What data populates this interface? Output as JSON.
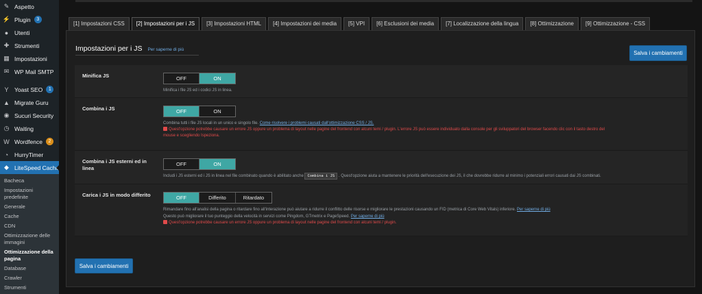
{
  "sidebar": {
    "items": [
      {
        "label": "Aspetto",
        "icon": "brush-icon"
      },
      {
        "label": "Plugin",
        "icon": "plugin-icon",
        "badge": "3"
      },
      {
        "label": "Utenti",
        "icon": "user-icon"
      },
      {
        "label": "Strumenti",
        "icon": "wrench-icon"
      },
      {
        "label": "Impostazioni",
        "icon": "settings-icon"
      },
      {
        "label": "WP Mail SMTP",
        "icon": "mail-icon"
      },
      {
        "label": "Yoast SEO",
        "icon": "yoast-icon",
        "badge": "1"
      },
      {
        "label": "Migrate Guru",
        "icon": "migrate-icon"
      },
      {
        "label": "Sucuri Security",
        "icon": "shield-icon"
      },
      {
        "label": "Waiting",
        "icon": "clock-icon"
      },
      {
        "label": "Wordfence",
        "icon": "wordfence-icon",
        "badge": "2"
      },
      {
        "label": "HurryTimer",
        "icon": "timer-icon"
      },
      {
        "label": "LiteSpeed Cache",
        "icon": "litespeed-icon"
      }
    ],
    "submenu": [
      "Bacheca",
      "Impostazioni predefinite",
      "Generale",
      "Cache",
      "CDN",
      "Ottimizzazione delle immagini",
      "Ottimizzazione della pagina",
      "Database",
      "Crawler",
      "Strumenti"
    ]
  },
  "tabs": [
    "[1] Impostazioni CSS",
    "[2] Impostazioni per i JS",
    "[3] Impostazioni HTML",
    "[4] Impostazioni dei media",
    "[5] VPI",
    "[6] Esclusioni dei media",
    "[7] Localizzazione della lingua",
    "[8] Ottimizzazione",
    "[9] Ottimizzazione - CSS"
  ],
  "section": {
    "title": "Impostazioni per i JS",
    "learn_more": "Per saperne di più",
    "save_label": "Salva i cambiamenti"
  },
  "options": {
    "minify": {
      "label": "Minifica JS",
      "off": "OFF",
      "on": "ON",
      "desc": "Minifica i file JS ed i codici JS in linea."
    },
    "combine": {
      "label": "Combina i JS",
      "off": "OFF",
      "on": "ON",
      "desc": "Combina tutti i file JS locali in un unico e singolo file.",
      "link": "Come risolvere i problemi causati dall'ottimizzazione CSS / JS.",
      "warn1": "Quest'opzione potrebbe causare un errore JS oppure un problema di layout nelle pagine del frontend con alcuni temi / plugin. L'errore JS può essere individuato dalla console per gli sviluppatori del browser facendo clic con il tasto destro del",
      "warn2": "mouse e scegliendo Ispeziona."
    },
    "combine_external": {
      "label": "Combina i JS esterni ed in linea",
      "off": "OFF",
      "on": "ON",
      "desc_before": "Includi i JS esterni ed i JS in linea nel file combinato quando è abilitato anche",
      "code": "Combina i JS",
      "desc_after": ". Quest'opzione aiuta a mantenere le priorità dell'esecuzione dei JS, il che dovrebbe ridurre al minimo i potenziali errori causati dai JS combinati."
    },
    "defer": {
      "label": "Carica i JS in modo differito",
      "off": "OFF",
      "deferred": "Differito",
      "delayed": "Ritardato",
      "desc1": "Rimandare fino all'analisi della pagina o ritardare fino all'interazione può aiutare a ridurre il conflitto delle risorse e migliorare le prestazioni causando un FID (metrica di Core Web Vitals) inferiore.",
      "desc1_link": "Per saperne di più",
      "desc2": "Questo può migliorare il tuo punteggio della velocità in servizi come Pingdom, GTmetrix e PageSpeed.",
      "desc2_link": "Per saperne di più",
      "warn": "Quest'opzione potrebbe causare un errore JS oppure un problema di layout nelle pagine del frontend con alcuni temi / plugin."
    }
  }
}
